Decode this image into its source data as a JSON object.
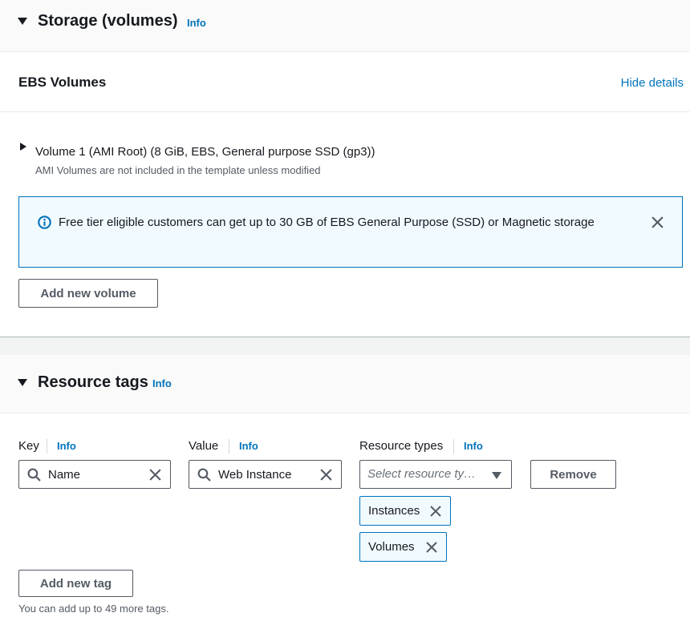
{
  "storage": {
    "title": "Storage (volumes)",
    "info": "Info",
    "ebs_title": "EBS Volumes",
    "hide_details": "Hide details",
    "volume": {
      "title": "Volume 1 (AMI Root) (8 GiB, EBS, General purpose SSD (gp3))",
      "subtitle": "AMI Volumes are not included in the template unless modified"
    },
    "alert": {
      "text": "Free tier eligible customers can get up to 30 GB of EBS General Purpose (SSD) or Magnetic storage"
    },
    "add_volume_label": "Add new volume"
  },
  "tags": {
    "title": "Resource tags",
    "info": "Info",
    "key": {
      "label": "Key",
      "info": "Info",
      "value": "Name"
    },
    "value": {
      "label": "Value",
      "info": "Info",
      "value": "Web Instance"
    },
    "resource_types": {
      "label": "Resource types",
      "info": "Info",
      "placeholder": "Select resource ty…",
      "selected": [
        "Instances",
        "Volumes"
      ]
    },
    "remove_label": "Remove",
    "add_tag_label": "Add new tag",
    "hint": "You can add up to 49 more tags."
  },
  "colors": {
    "link": "#0073bb",
    "text": "#16191f",
    "alert_bg": "#f1faff",
    "border": "#545b64"
  },
  "icons": {
    "section_caret": "caret-down-icon",
    "volume_caret": "caret-right-icon",
    "alert": "info-circle-icon",
    "close": "close-icon",
    "search": "search-icon",
    "dropdown": "chevron-down-icon"
  }
}
